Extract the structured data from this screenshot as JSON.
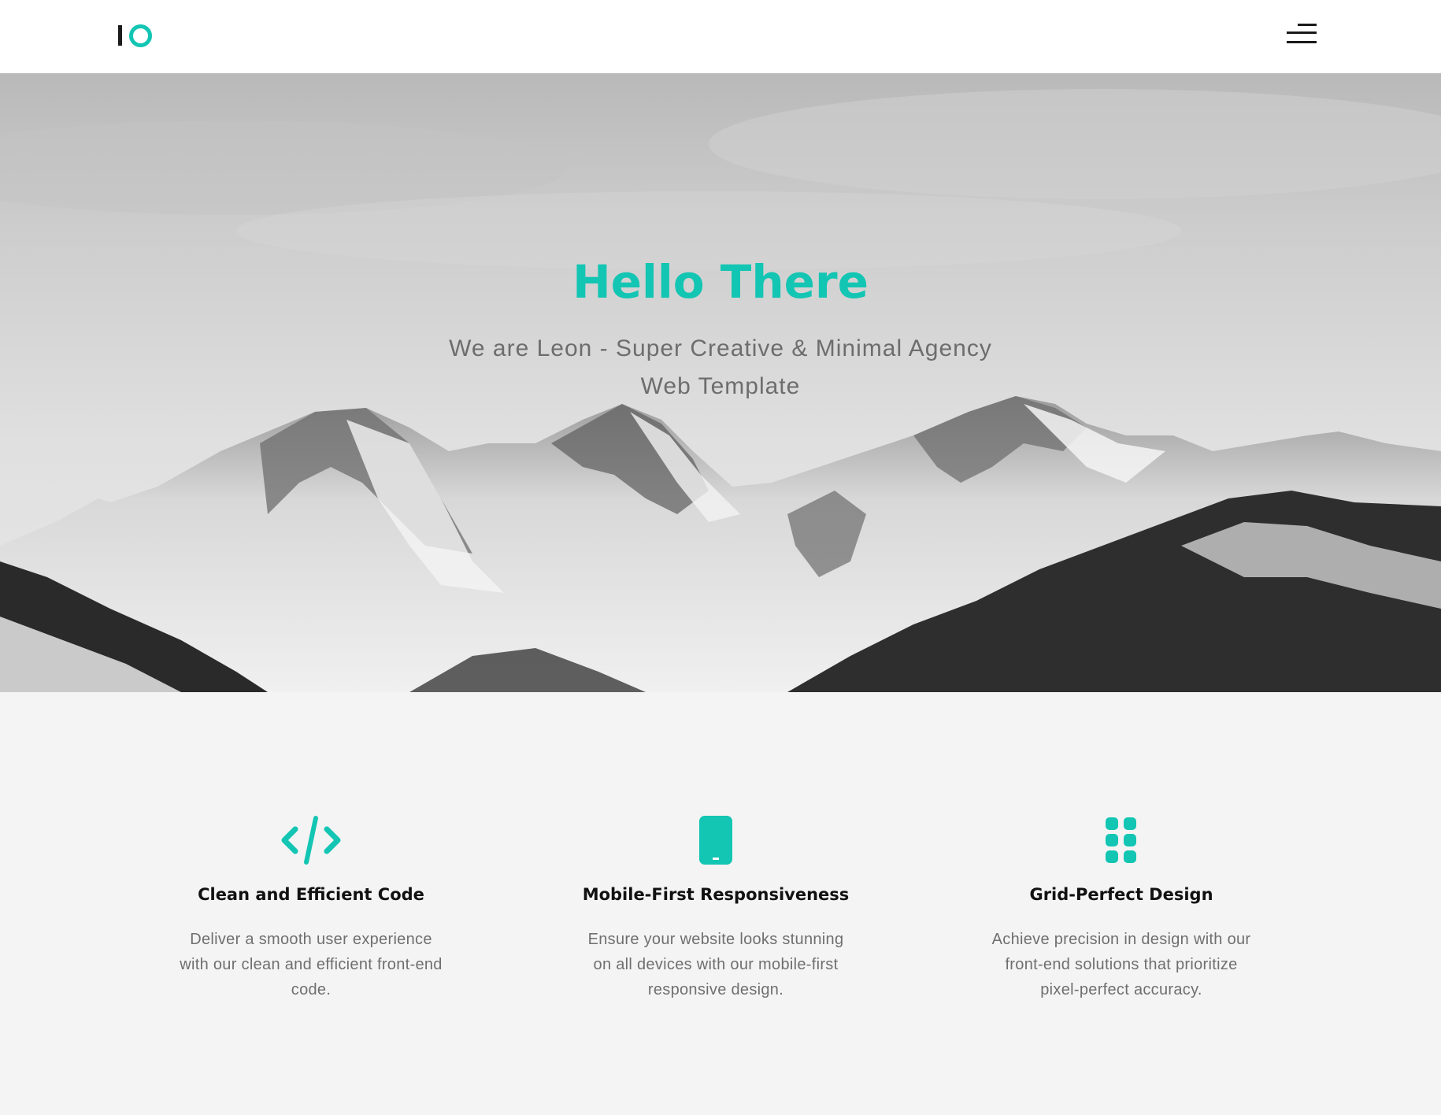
{
  "colors": {
    "accent": "#13c5b3",
    "header_bg": "#ffffff",
    "section_bg": "#f4f4f4",
    "text_dark": "#111111",
    "text_muted": "#6f6f6f"
  },
  "header": {
    "logo_icon": "io-logo",
    "menu_icon": "hamburger-menu-icon"
  },
  "hero": {
    "title": "Hello There",
    "subtitle": "We are Leon - Super Creative & Minimal Agency Web Template",
    "background": "snowy-mountain-range-grayscale"
  },
  "features": [
    {
      "icon": "code-icon",
      "title": "Clean and Efficient Code",
      "description": "Deliver a smooth user experience with our clean and efficient front-end code."
    },
    {
      "icon": "mobile-icon",
      "title": "Mobile-First Responsiveness",
      "description": "Ensure your website looks stunning on all devices with our mobile-first responsive design."
    },
    {
      "icon": "grid-icon",
      "title": "Grid-Perfect Design",
      "description": "Achieve precision in design with our front-end solutions that prioritize pixel-perfect accuracy."
    }
  ]
}
